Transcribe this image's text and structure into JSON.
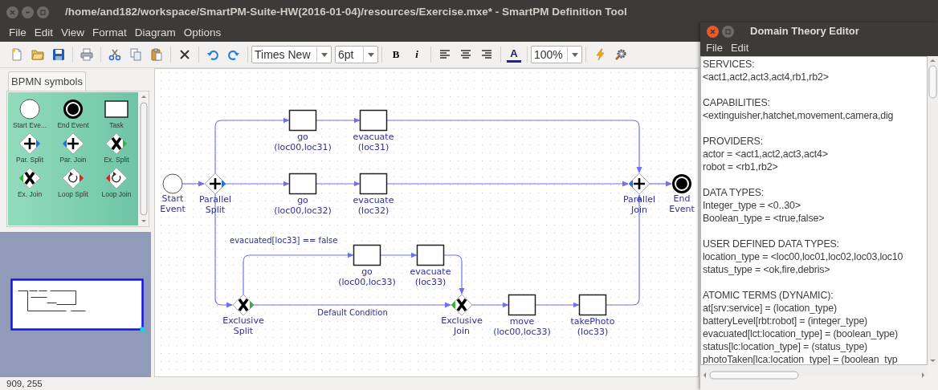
{
  "window": {
    "title": "/home/and182/workspace/SmartPM-Suite-HW(2016-01-04)/resources/Exercise.mxe* - SmartPM Definition Tool",
    "menu": [
      "File",
      "Edit",
      "View",
      "Format",
      "Diagram",
      "Options"
    ]
  },
  "toolbar": {
    "font": "Times New",
    "font_size": "6pt",
    "bold": "B",
    "italic": "i",
    "font_color": "A",
    "zoom": "100%"
  },
  "palette": {
    "tab": "BPMN symbols",
    "items": [
      {
        "kind": "start",
        "label": "Start Eve..."
      },
      {
        "kind": "end",
        "label": "End Event"
      },
      {
        "kind": "task",
        "label": "Task"
      },
      {
        "kind": "parallel_split",
        "label": "Par. Split"
      },
      {
        "kind": "parallel_join",
        "label": "Par. Join"
      },
      {
        "kind": "exclusive_split",
        "label": "Ex. Split"
      },
      {
        "kind": "exclusive_join",
        "label": "Ex. Join"
      },
      {
        "kind": "loop_split",
        "label": "Loop Split"
      },
      {
        "kind": "loop_join",
        "label": "Loop Join"
      }
    ]
  },
  "diagram": {
    "nodes": [
      {
        "kind": "start",
        "label": [
          "Start",
          "Event"
        ]
      },
      {
        "kind": "parallel_split",
        "label": [
          "Parallel",
          "Split"
        ]
      },
      {
        "kind": "task",
        "label": [
          "go",
          "(loc00,loc31)"
        ]
      },
      {
        "kind": "task",
        "label": [
          "evacuate",
          "(loc31)"
        ]
      },
      {
        "kind": "task",
        "label": [
          "go",
          "(loc00,loc32)"
        ]
      },
      {
        "kind": "task",
        "label": [
          "evacuate",
          "(loc32)"
        ]
      },
      {
        "kind": "parallel_join",
        "label": [
          "Parallel",
          "Join"
        ]
      },
      {
        "kind": "end",
        "label": [
          "End",
          "Event"
        ]
      },
      {
        "kind": "exclusive_split",
        "label": [
          "Exclusive",
          "Split"
        ]
      },
      {
        "kind": "task",
        "label": [
          "go",
          "(loc00,loc33)"
        ]
      },
      {
        "kind": "task",
        "label": [
          "evacuate",
          "(loc33)"
        ]
      },
      {
        "kind": "exclusive_join",
        "label": [
          "Exclusive",
          "Join"
        ]
      },
      {
        "kind": "task",
        "label": [
          "move",
          "(loc00,loc33)"
        ]
      },
      {
        "kind": "task",
        "label": [
          "takePhoto",
          "(loc33)"
        ]
      }
    ],
    "edge_labels": [
      "evacuated[loc33] == false",
      "Default Condition"
    ]
  },
  "status_bar": "909, 255",
  "domain_editor": {
    "title": "Domain Theory Editor",
    "menu": [
      "File",
      "Edit"
    ],
    "sections": [
      {
        "heading": "SERVICES:",
        "lines": [
          "<act1,act2,act3,act4,rb1,rb2>"
        ]
      },
      {
        "heading": "CAPABILITIES:",
        "lines": [
          "<extinguisher,hatchet,movement,camera,dig"
        ]
      },
      {
        "heading": "PROVIDERS:",
        "lines": [
          "actor = <act1,act2,act3,act4>",
          "robot = <rb1,rb2>"
        ]
      },
      {
        "heading": "DATA TYPES:",
        "lines": [
          "Integer_type = <0..30>",
          "Boolean_type = <true,false>"
        ]
      },
      {
        "heading": "USER DEFINED DATA TYPES:",
        "lines": [
          "location_type = <loc00,loc01,loc02,loc03,loc10",
          "status_type = <ok,fire,debris>"
        ]
      },
      {
        "heading": "ATOMIC TERMS (DYNAMIC):",
        "lines": [
          "at[srv:service] = (location_type)",
          "batteryLevel[rbt:robot] = (integer_type)",
          "evacuated[lct:location_type] = (boolean_type)",
          "status[lc:location_type] = (status_type)",
          "photoTaken[lca:location_type] = (boolean_typ"
        ]
      }
    ]
  }
}
